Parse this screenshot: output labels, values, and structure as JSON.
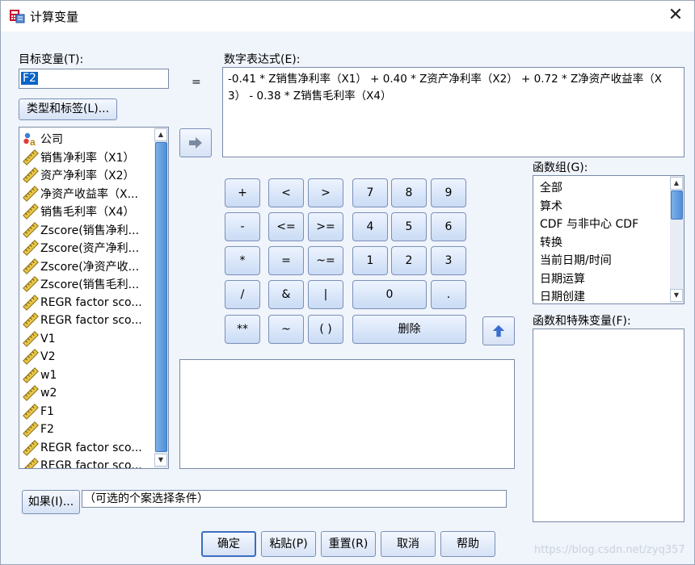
{
  "window": {
    "title": "计算变量",
    "close_glyph": "✕"
  },
  "target": {
    "label": "目标变量(T):",
    "value": "F2"
  },
  "equals": "=",
  "type_label_button": "类型和标签(L)...",
  "expression": {
    "label": "数字表达式(E):",
    "line1": "-0.41 * Z销售净利率（X1） + 0.40 * Z资产净利率（X2） + 0.72 * Z净资产收益率（X",
    "line2": "3） - 0.38 * Z销售毛利率（X4）"
  },
  "variables": [
    {
      "name": "公司",
      "icon": "nominal-icon"
    },
    {
      "name": "销售净利率（X1）",
      "icon": "ruler-icon"
    },
    {
      "name": "资产净利率（X2）",
      "icon": "ruler-icon"
    },
    {
      "name": "净资产收益率（X...",
      "icon": "ruler-icon"
    },
    {
      "name": "销售毛利率（X4）",
      "icon": "ruler-icon"
    },
    {
      "name": "Zscore(销售净利...",
      "icon": "ruler-icon"
    },
    {
      "name": "Zscore(资产净利...",
      "icon": "ruler-icon"
    },
    {
      "name": "Zscore(净资产收...",
      "icon": "ruler-icon"
    },
    {
      "name": "Zscore(销售毛利...",
      "icon": "ruler-icon"
    },
    {
      "name": "REGR factor sco...",
      "icon": "ruler-icon"
    },
    {
      "name": "REGR factor sco...",
      "icon": "ruler-icon"
    },
    {
      "name": "V1",
      "icon": "ruler-icon"
    },
    {
      "name": "V2",
      "icon": "ruler-icon"
    },
    {
      "name": "w1",
      "icon": "ruler-icon"
    },
    {
      "name": "w2",
      "icon": "ruler-icon"
    },
    {
      "name": "F1",
      "icon": "ruler-icon"
    },
    {
      "name": "F2",
      "icon": "ruler-icon"
    },
    {
      "name": "REGR factor sco...",
      "icon": "ruler-icon"
    },
    {
      "name": "REGR factor sco...",
      "icon": "ruler-icon"
    }
  ],
  "keypad": {
    "plus": "+",
    "lt": "<",
    "gt": ">",
    "n7": "7",
    "n8": "8",
    "n9": "9",
    "minus": "-",
    "le": "<=",
    "ge": ">=",
    "n4": "4",
    "n5": "5",
    "n6": "6",
    "mul": "*",
    "eq": "=",
    "ne": "~=",
    "n1": "1",
    "n2": "2",
    "n3": "3",
    "div": "/",
    "and": "&",
    "or": "|",
    "n0": "0",
    "dot": ".",
    "pow": "**",
    "not": "~",
    "paren": "( )",
    "delete": "删除"
  },
  "function_group": {
    "label": "函数组(G):",
    "items": [
      "全部",
      "算术",
      "CDF 与非中心 CDF",
      "转换",
      "当前日期/时间",
      "日期运算",
      "日期创建"
    ]
  },
  "functions_special": {
    "label": "函数和特殊变量(F):"
  },
  "if_button": "如果(I)...",
  "if_condition": "（可选的个案选择条件）",
  "buttons": {
    "ok": "确定",
    "paste": "粘贴(P)",
    "reset": "重置(R)",
    "cancel": "取消",
    "help": "帮助"
  },
  "watermark": "https://blog.csdn.net/zyq357",
  "colors": {
    "accent": "#3c6ec0",
    "selection": "#0a64c8",
    "thumb": "#4f8fd8"
  }
}
